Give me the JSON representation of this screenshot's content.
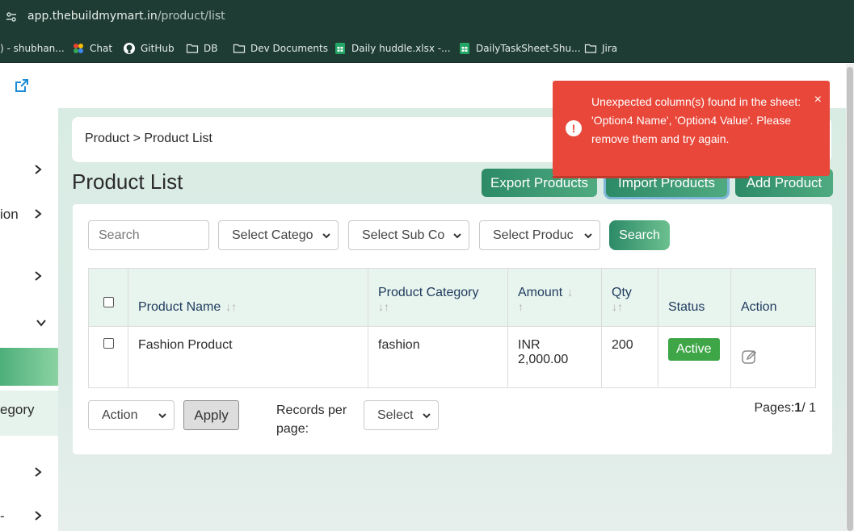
{
  "browser": {
    "url_host": "app.thebuildmymart.in",
    "url_path": "/product/list"
  },
  "bookmarks": [
    {
      "label": ") - shubhan..."
    },
    {
      "label": "Chat"
    },
    {
      "label": "GitHub"
    },
    {
      "label": "DB"
    },
    {
      "label": "Dev Documents"
    },
    {
      "label": "Daily huddle.xlsx -..."
    },
    {
      "label": "DailyTaskSheet-Shu..."
    },
    {
      "label": "Jira"
    }
  ],
  "sidebar": {
    "items": [
      {
        "label": ""
      },
      {
        "label": "ion"
      },
      {
        "label": ""
      },
      {
        "label": ""
      },
      {
        "label": "egory"
      },
      {
        "label": ""
      },
      {
        "label": "-"
      }
    ]
  },
  "breadcrumb": "Product > Product List",
  "page_title": "Product List",
  "buttons": {
    "export": "Export Products",
    "import": "Import Products",
    "add": "Add Product"
  },
  "filters": {
    "search_placeholder": "Search",
    "category": "Select Catego",
    "sub_category": "Select Sub Co",
    "product": "Select Produc",
    "search_button": "Search"
  },
  "table": {
    "headers": {
      "name": "Product Name",
      "category": "Product Category",
      "amount": "Amount",
      "qty": "Qty",
      "status": "Status",
      "action": "Action"
    },
    "rows": [
      {
        "name": "Fashion Product",
        "category": "fashion",
        "amount": "INR 2,000.00",
        "qty": "200",
        "status": "Active"
      }
    ]
  },
  "footer": {
    "action_select": "Action",
    "apply": "Apply",
    "records_per_page_line1": "Records per",
    "records_per_page_line2": "page:",
    "records_select": "Select",
    "pages_label": "Pages:",
    "pages_current": "1",
    "pages_total": "/ 1"
  },
  "toast": {
    "message": "Unexpected column(s) found in the sheet: 'Option4 Name', 'Option4 Value'. Please remove them and try again.",
    "close": "×",
    "icon": "!",
    "color": "#e9473a"
  }
}
